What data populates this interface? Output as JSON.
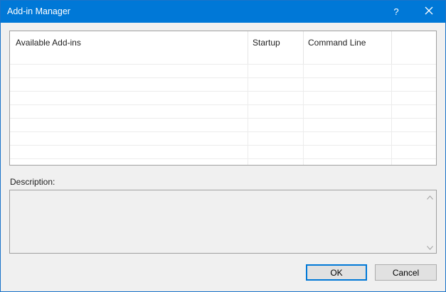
{
  "window": {
    "title": "Add-in Manager",
    "help_glyph": "?",
    "colors": {
      "titlebar": "#0078d7",
      "accent": "#0078d7"
    }
  },
  "addins_list": {
    "columns": [
      "Available Add-ins",
      "Startup",
      "Command Line",
      ""
    ],
    "rows": []
  },
  "description": {
    "label": "Description:",
    "text": ""
  },
  "buttons": {
    "ok_label": "OK",
    "cancel_label": "Cancel"
  },
  "icons": {
    "close": "close-icon",
    "help": "help-icon",
    "scroll_up": "chevron-up-icon",
    "scroll_down": "chevron-down-icon"
  }
}
